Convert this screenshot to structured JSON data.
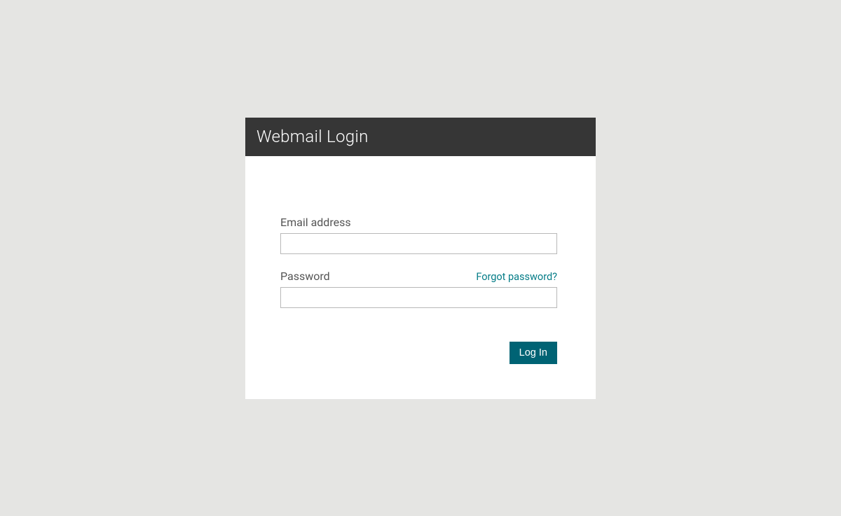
{
  "header": {
    "title": "Webmail Login"
  },
  "form": {
    "email_label": "Email address",
    "email_value": "",
    "password_label": "Password",
    "password_value": "",
    "forgot_link": "Forgot password?",
    "submit_label": "Log In"
  }
}
